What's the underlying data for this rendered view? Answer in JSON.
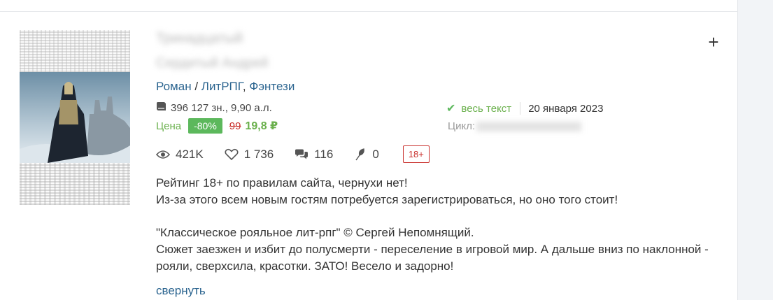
{
  "book": {
    "title": "Тринадцатый",
    "author": "Сердитый Андрей",
    "genres": [
      {
        "label": "Роман"
      },
      {
        "label": "ЛитРПГ"
      },
      {
        "label": "Фэнтези"
      }
    ],
    "genre_separator_1": "/",
    "genre_separator_2": ",",
    "size": "396 127 зн., 9,90 а.л.",
    "price": {
      "label": "Цена",
      "discount": "-80%",
      "old": "99",
      "new": "19,8 ₽"
    },
    "status": {
      "full_text_label": "весь текст",
      "date": "20 января 2023"
    },
    "cycle_label": "Цикл:",
    "stats": {
      "views": "421K",
      "likes": "1 736",
      "comments": "116",
      "awards": "0"
    },
    "age_rating": "18+",
    "description": {
      "line1": "Рейтинг 18+ по правилам сайта, чернухи нет!",
      "line2": "Из-за этого всем новым гостям потребуется зарегистрироваться, но оно того стоит!",
      "line3": "\"Классическое рояльное лит-рпг\" © Сергей Непомнящий.",
      "line4": "Сюжет заезжен и избит до полусмерти - переселение в игровой мир. А дальше вниз по наклонной - рояли, сверхсила, красотки. ЗАТО! Весело и задорно!"
    },
    "collapse_label": "свернуть"
  },
  "actions": {
    "add_label": "+"
  },
  "colors": {
    "link": "#2c6590",
    "green": "#5cb85c",
    "red": "#c9302c"
  },
  "icons": [
    "book-icon",
    "check-icon",
    "eye-icon",
    "heart-icon",
    "comments-icon",
    "feather-icon",
    "plus-icon"
  ]
}
